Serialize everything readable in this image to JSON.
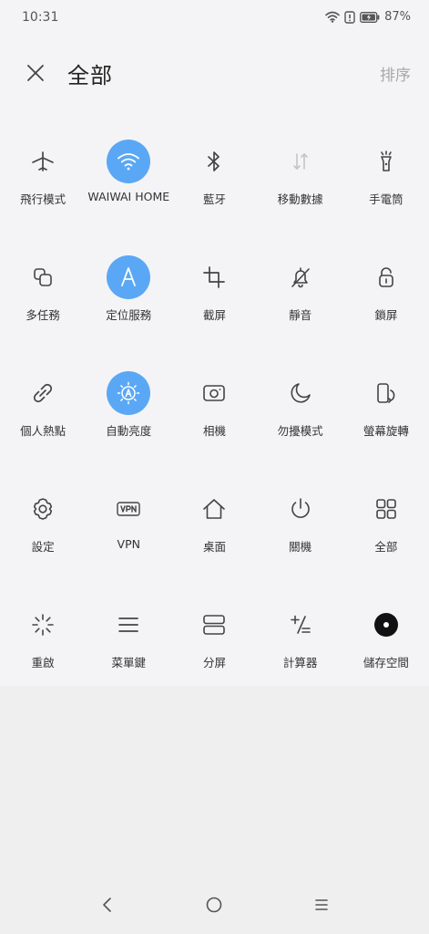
{
  "status": {
    "time": "10:31",
    "battery": "87%",
    "icons": [
      "wifi-icon",
      "alert-icon",
      "battery-icon"
    ]
  },
  "header": {
    "title": "全部",
    "sort_label": "排序",
    "close_icon": "close-icon"
  },
  "accent_color": "#5aa8f5",
  "tiles": [
    [
      {
        "label": "飛行模式",
        "icon": "airplane-icon",
        "active": false
      },
      {
        "label": "WAIWAI HOME",
        "icon": "wifi-icon",
        "active": true
      },
      {
        "label": "藍牙",
        "icon": "bluetooth-icon",
        "active": false
      },
      {
        "label": "移動數據",
        "icon": "mobile-data-icon",
        "active": false,
        "disabled": true
      },
      {
        "label": "手電筒",
        "icon": "flashlight-icon",
        "active": false
      }
    ],
    [
      {
        "label": "多任務",
        "icon": "multitask-icon",
        "active": false
      },
      {
        "label": "定位服務",
        "icon": "location-icon",
        "active": true
      },
      {
        "label": "截屏",
        "icon": "screenshot-icon",
        "active": false
      },
      {
        "label": "靜音",
        "icon": "mute-icon",
        "active": false
      },
      {
        "label": "鎖屏",
        "icon": "lock-icon",
        "active": false
      }
    ],
    [
      {
        "label": "個人熱點",
        "icon": "hotspot-icon",
        "active": false
      },
      {
        "label": "自動亮度",
        "icon": "auto-brightness-icon",
        "active": true
      },
      {
        "label": "相機",
        "icon": "camera-icon",
        "active": false
      },
      {
        "label": "勿擾模式",
        "icon": "moon-icon",
        "active": false
      },
      {
        "label": "螢幕旋轉",
        "icon": "rotate-icon",
        "active": false
      }
    ],
    [
      {
        "label": "設定",
        "icon": "gear-icon",
        "active": false
      },
      {
        "label": "VPN",
        "icon": "vpn-icon",
        "active": false
      },
      {
        "label": "桌面",
        "icon": "home-icon",
        "active": false
      },
      {
        "label": "關機",
        "icon": "power-icon",
        "active": false
      },
      {
        "label": "全部",
        "icon": "grid-icon",
        "active": false
      }
    ],
    [
      {
        "label": "重啟",
        "icon": "restart-icon",
        "active": false
      },
      {
        "label": "菜單鍵",
        "icon": "menu-icon",
        "active": false
      },
      {
        "label": "分屏",
        "icon": "split-screen-icon",
        "active": false
      },
      {
        "label": "計算器",
        "icon": "calculator-icon",
        "active": false
      },
      {
        "label": "儲存空間",
        "icon": "storage-icon",
        "active": false
      }
    ]
  ],
  "navbar": {
    "icons": [
      "back-icon",
      "home-circle-icon",
      "recents-icon"
    ]
  }
}
